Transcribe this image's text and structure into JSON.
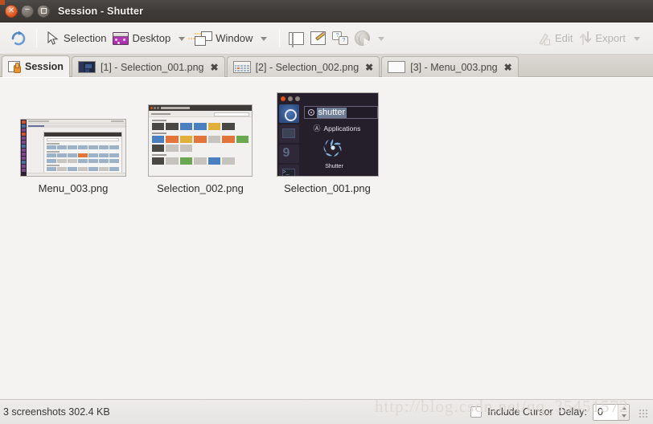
{
  "window": {
    "title": "Session - Shutter",
    "controls": {
      "close": "close-button",
      "minimize": "minimize-button",
      "maximize": "maximize-button"
    }
  },
  "toolbar": {
    "redo_icon": "refresh-icon",
    "selection_label": "Selection",
    "desktop_label": "Desktop",
    "window_label": "Window",
    "section_icon": "section-icon",
    "menu_icon": "menu-pencil-icon",
    "tooltip_icon": "tooltip-icon",
    "web_icon": "web-globe-icon",
    "edit_label": "Edit",
    "export_label": "Export"
  },
  "tabs": [
    {
      "label": "Session",
      "icon": "session-icon",
      "active": true,
      "closable": false
    },
    {
      "label": "[1] - Selection_001.png",
      "icon": "thumb-dash",
      "active": false,
      "closable": true,
      "close_glyph": "✖"
    },
    {
      "label": "[2] - Selection_002.png",
      "icon": "thumb-settings",
      "active": false,
      "closable": true,
      "close_glyph": "✖"
    },
    {
      "label": "[3] - Menu_003.png",
      "icon": "thumb-menu",
      "active": false,
      "closable": true,
      "close_glyph": "✖"
    }
  ],
  "session": {
    "thumbnails": [
      {
        "filename": "Menu_003.png",
        "kind": "desktop-with-settings-window"
      },
      {
        "filename": "Selection_002.png",
        "kind": "system-settings-window"
      },
      {
        "filename": "Selection_001.png",
        "kind": "unity-dash-search"
      }
    ]
  },
  "dash_shot": {
    "query": "shutter",
    "category": "Applications",
    "result_name": "Shutter",
    "applications_glyph": "Ⓐ"
  },
  "statusbar": {
    "count_and_size": "3 screenshots  302.4 KB",
    "include_cursor_label": "Include Cursor",
    "include_cursor_checked": false,
    "delay_label": "Delay:",
    "delay_value": "0"
  },
  "watermark": {
    "text": "http://blog.csdn.net/qq_35451572"
  },
  "colors": {
    "titlebar": "#3f3b38",
    "close_button": "#df5118",
    "accent_orange": "#e2763a",
    "toolbar_bg": "#f1efee",
    "content_bg": "#f4f3f2",
    "disabled_text": "#b8b6b2",
    "dash_bg": "#241f2b"
  }
}
